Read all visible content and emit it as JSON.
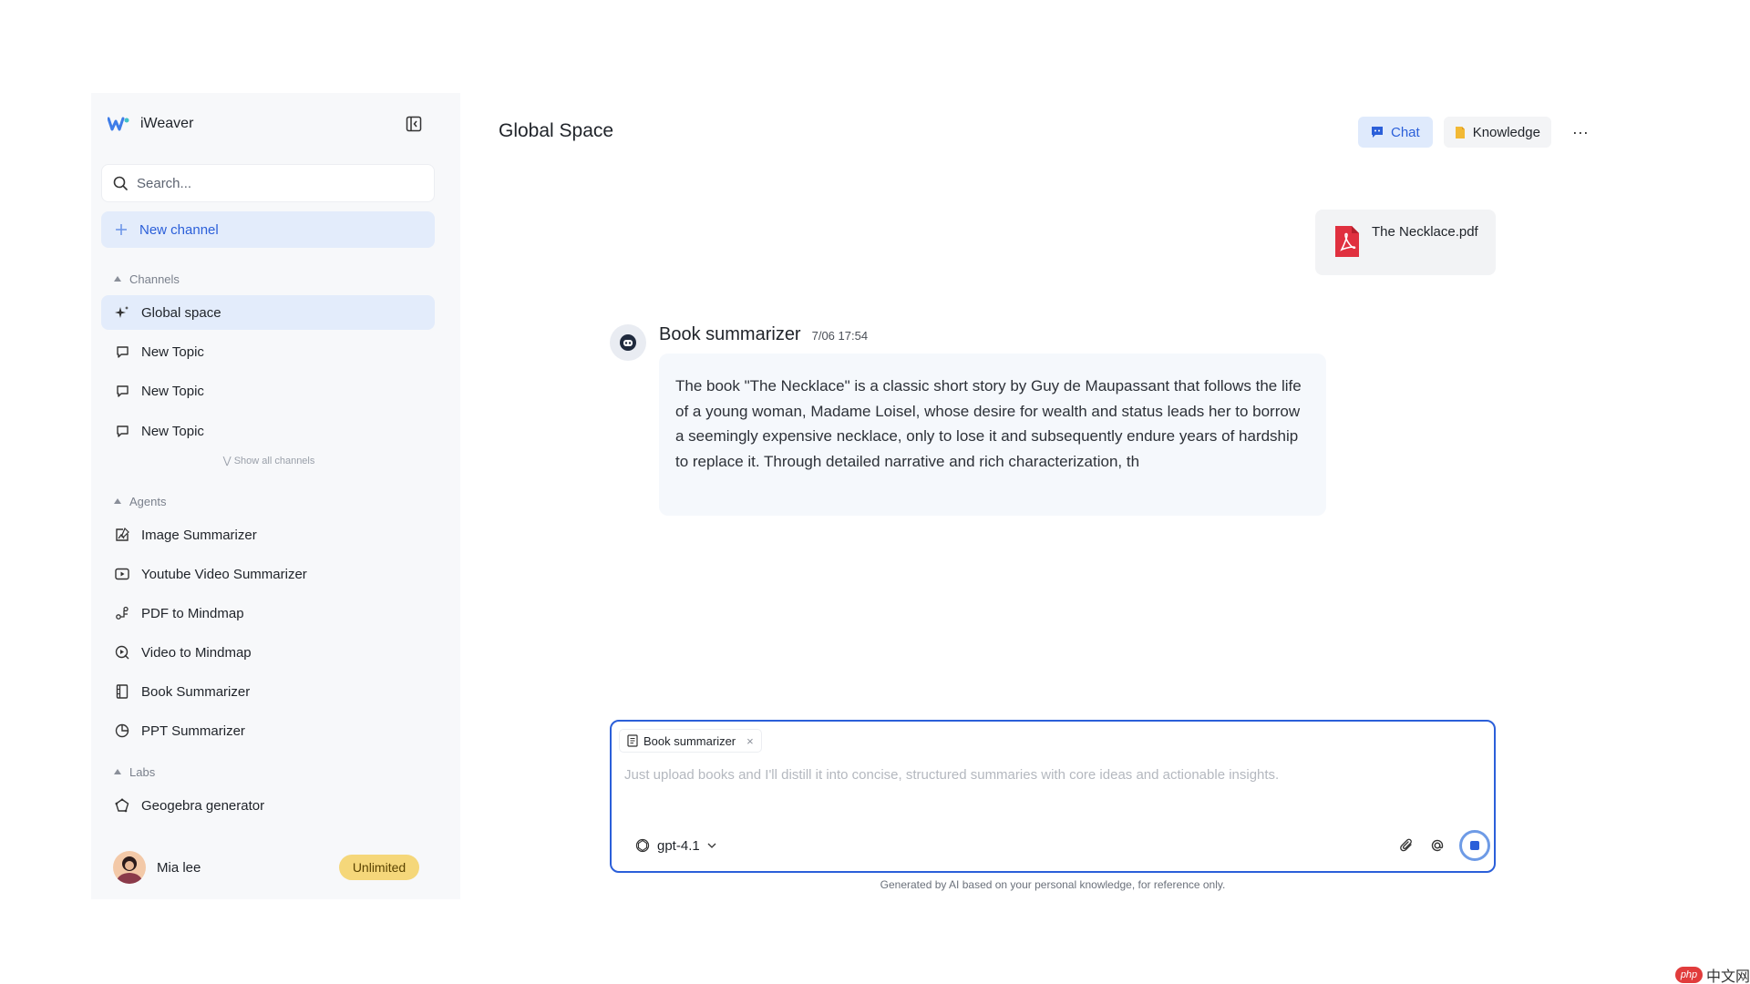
{
  "brand": {
    "name": "iWeaver"
  },
  "search": {
    "placeholder": "Search..."
  },
  "new_channel_label": "New channel",
  "channels": {
    "heading": "Channels",
    "items": [
      {
        "label": "Global space",
        "icon": "sparkle-icon"
      },
      {
        "label": "New Topic",
        "icon": "chat-bubble-icon"
      },
      {
        "label": "New Topic",
        "icon": "chat-bubble-icon"
      },
      {
        "label": "New Topic",
        "icon": "chat-bubble-icon"
      }
    ],
    "show_all": "Show all channels"
  },
  "agents": {
    "heading": "Agents",
    "items": [
      {
        "label": "Image Summarizer",
        "icon": "image-edit-icon"
      },
      {
        "label": "Youtube Video Summarizer",
        "icon": "video-play-icon"
      },
      {
        "label": "PDF to Mindmap",
        "icon": "mindmap-icon"
      },
      {
        "label": "Video to Mindmap",
        "icon": "video-mindmap-icon"
      },
      {
        "label": "Book Summarizer",
        "icon": "book-icon"
      },
      {
        "label": "PPT Summarizer",
        "icon": "pie-chart-icon"
      }
    ]
  },
  "labs": {
    "heading": "Labs",
    "items": [
      {
        "label": "Geogebra generator",
        "icon": "geometry-icon"
      }
    ]
  },
  "user": {
    "name": "Mia lee",
    "plan": "Unlimited"
  },
  "header": {
    "title": "Global Space",
    "chat_label": "Chat",
    "knowledge_label": "Knowledge",
    "more": "···"
  },
  "attachment": {
    "file_name": "The Necklace.pdf"
  },
  "message": {
    "sender": "Book summarizer",
    "time": "7/06 17:54",
    "text": "The book \"The Necklace\" is a classic short story by Guy de Maupassant that follows the life of a young woman, Madame Loisel, whose desire for wealth and status leads her to borrow a seemingly expensive necklace, only to lose it and subsequently endure years of hardship to replace it. Through detailed narrative and rich characterization, th"
  },
  "composer": {
    "agent_chip": "Book summarizer",
    "chip_close": "×",
    "placeholder": "Just upload books and I'll distill it into concise, structured summaries with core ideas and actionable insights.",
    "model": "gpt-4.1"
  },
  "disclaimer": "Generated by AI based on your personal knowledge, for reference only.",
  "watermark": {
    "logo": "php",
    "text": "中文网"
  },
  "colors": {
    "accent": "#2b5fd9",
    "active_bg": "#e3ecfb",
    "badge": "#f5d77a",
    "pdf_red": "#e0303f"
  }
}
